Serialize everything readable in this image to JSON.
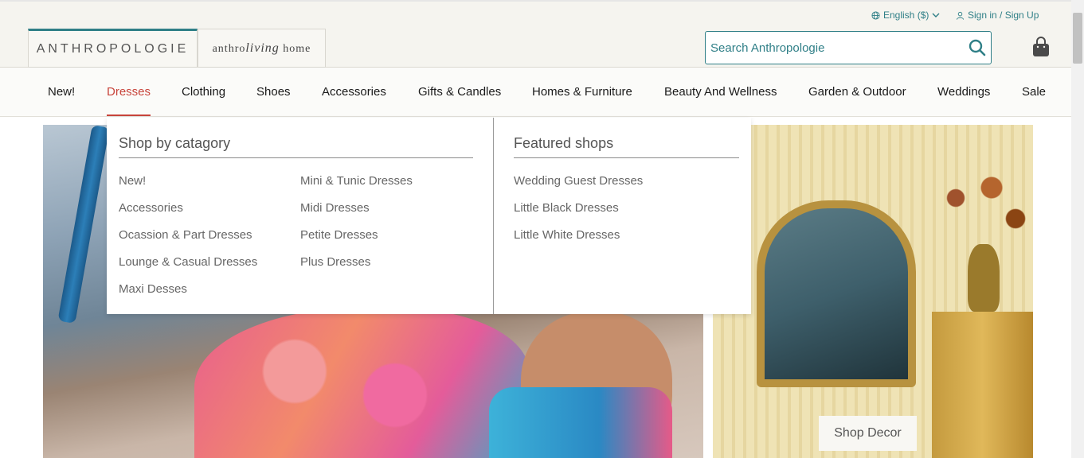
{
  "utility": {
    "language": "English ($)",
    "sign_in": "Sign in / Sign Up"
  },
  "header": {
    "logo": "ANTHROPOLOGIE",
    "living_home": {
      "left": "anthro",
      "script": "living",
      "right": "home"
    },
    "search_placeholder": "Search Anthropologie"
  },
  "nav": {
    "items": [
      {
        "label": "New!"
      },
      {
        "label": "Dresses"
      },
      {
        "label": "Clothing"
      },
      {
        "label": "Shoes"
      },
      {
        "label": "Accessories"
      },
      {
        "label": "Gifts & Candles"
      },
      {
        "label": "Homes & Furniture"
      },
      {
        "label": "Beauty And Wellness"
      },
      {
        "label": "Garden & Outdoor"
      },
      {
        "label": "Weddings"
      },
      {
        "label": "Sale"
      }
    ],
    "active": "Dresses"
  },
  "dropdown": {
    "category_heading": "Shop by catagory",
    "category_col1": [
      "New!",
      "Accessories",
      "Ocassion & Part Dresses",
      "Lounge & Casual Dresses",
      "Maxi Desses"
    ],
    "category_col2": [
      "Mini & Tunic Dresses",
      "Midi Dresses",
      "Petite Dresses",
      "Plus Dresses"
    ],
    "featured_heading": "Featured shops",
    "featured": [
      "Wedding Guest Dresses",
      "Little Black Dresses",
      "Little White Dresses"
    ]
  },
  "hero": {
    "shop_decor": "Shop Decor"
  },
  "colors": {
    "teal_accent": "#2f7f87",
    "active_nav": "#c8453c",
    "header_bg": "#f5f4ef"
  }
}
